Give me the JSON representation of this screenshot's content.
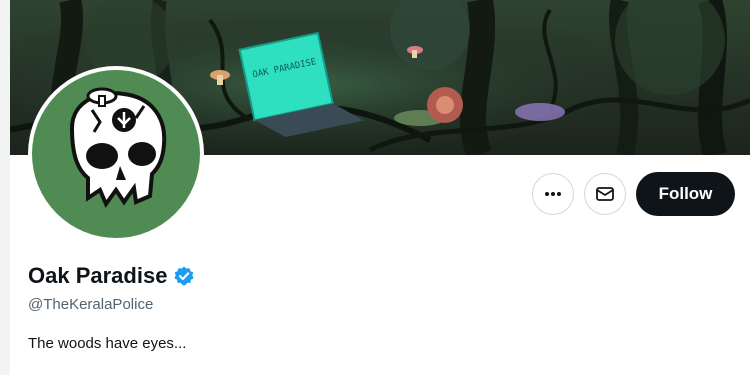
{
  "banner": {
    "screen_text": "OAK PARADISE",
    "icon": "forest-illustration"
  },
  "avatar": {
    "icon": "skull-icon",
    "background": "#4f8b52"
  },
  "actions": {
    "more_icon": "more-horizontal-icon",
    "message_icon": "envelope-icon",
    "follow_label": "Follow"
  },
  "profile": {
    "name": "Oak Paradise",
    "verified_icon": "verified-badge-icon",
    "handle": "@TheKeralaPolice",
    "bio": "The woods have eyes..."
  },
  "colors": {
    "verified": "#1d9bf0",
    "follow_bg": "#0f1419",
    "handle_text": "#536471",
    "screen_glow": "#2fe0c0"
  }
}
